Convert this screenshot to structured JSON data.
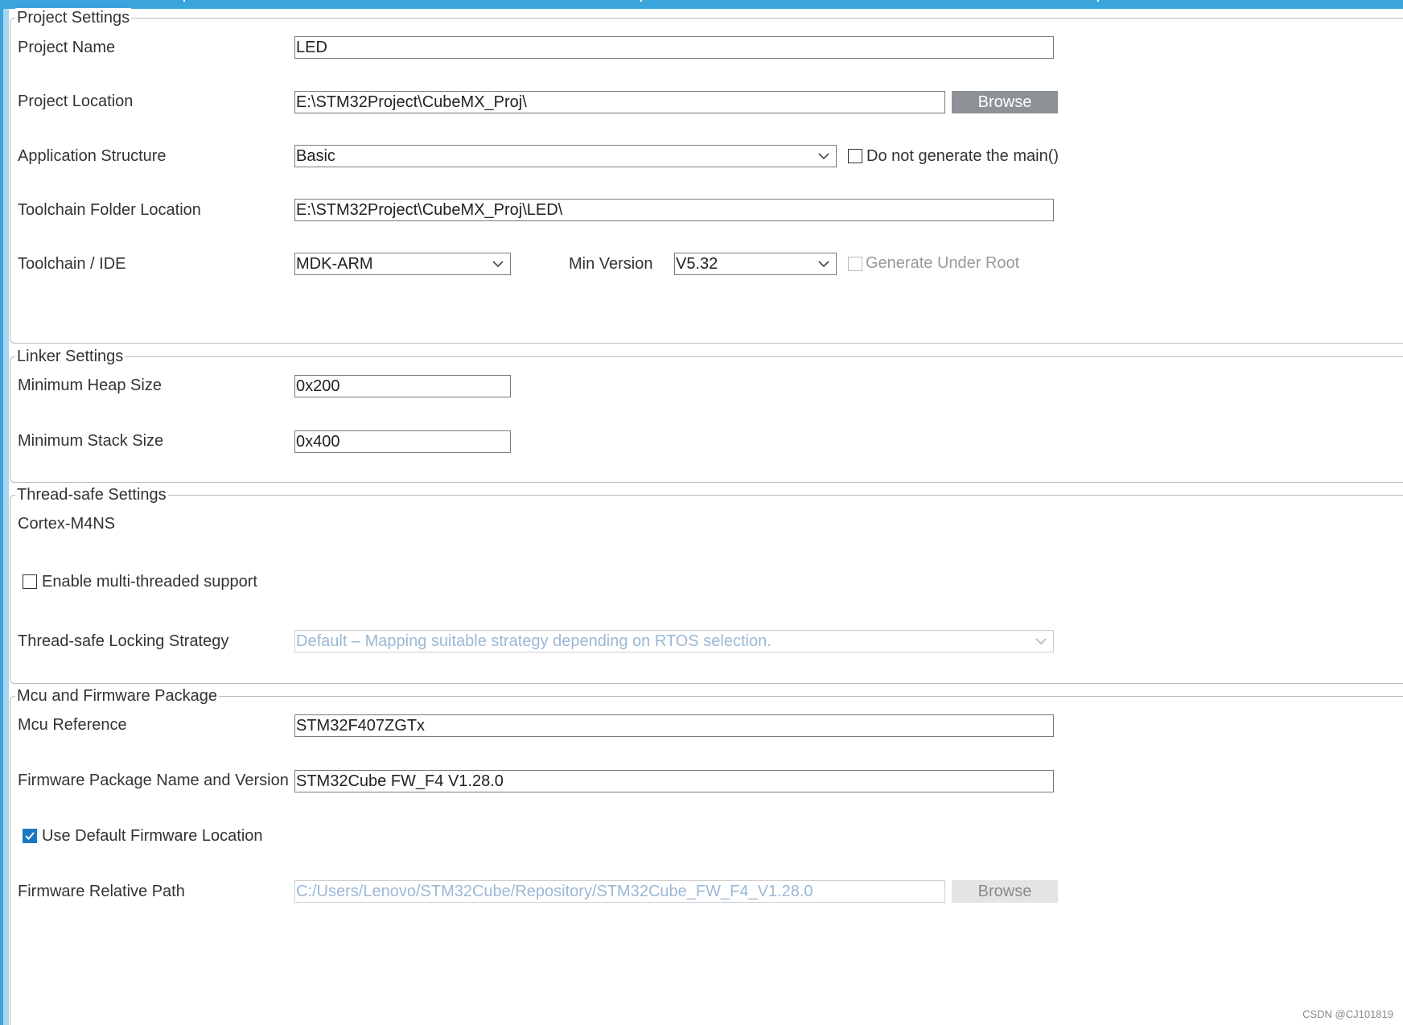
{
  "theme": {
    "accent": "#3aa5dc",
    "button_bg": "#8e9296",
    "checked_blue": "#1a78c2"
  },
  "project_settings": {
    "legend": "Project Settings",
    "project_name_label": "Project Name",
    "project_name_value": "LED",
    "project_location_label": "Project Location",
    "project_location_value": "E:\\STM32Project\\CubeMX_Proj\\",
    "browse_label": "Browse",
    "application_structure_label": "Application Structure",
    "application_structure_value": "Basic",
    "do_not_generate_main_label": "Do not generate the main()",
    "do_not_generate_main_checked": false,
    "toolchain_folder_label": "Toolchain Folder Location",
    "toolchain_folder_value": "E:\\STM32Project\\CubeMX_Proj\\LED\\",
    "toolchain_ide_label": "Toolchain / IDE",
    "toolchain_ide_value": "MDK-ARM",
    "min_version_label": "Min Version",
    "min_version_value": "V5.32",
    "generate_under_root_label": "Generate Under Root",
    "generate_under_root_checked": false
  },
  "linker_settings": {
    "legend": "Linker Settings",
    "min_heap_label": "Minimum Heap Size",
    "min_heap_value": "0x200",
    "min_stack_label": "Minimum Stack Size",
    "min_stack_value": "0x400"
  },
  "thread_safe_settings": {
    "legend": "Thread-safe Settings",
    "core_label": "Cortex-M4NS",
    "enable_multithread_label": "Enable multi-threaded support",
    "enable_multithread_checked": false,
    "locking_strategy_label": "Thread-safe Locking Strategy",
    "locking_strategy_value": "Default  –  Mapping suitable strategy depending on RTOS selection."
  },
  "mcu_firmware": {
    "legend": "Mcu and Firmware Package",
    "mcu_reference_label": "Mcu Reference",
    "mcu_reference_value": "STM32F407ZGTx",
    "firmware_package_label": "Firmware Package Name and Version",
    "firmware_package_value": "STM32Cube FW_F4 V1.28.0",
    "use_default_location_label": "Use Default Firmware Location",
    "use_default_location_checked": true,
    "firmware_path_label": "Firmware Relative Path",
    "firmware_path_value": "C:/Users/Lenovo/STM32Cube/Repository/STM32Cube_FW_F4_V1.28.0",
    "browse_label": "Browse"
  },
  "watermark": "CSDN @CJ101819"
}
